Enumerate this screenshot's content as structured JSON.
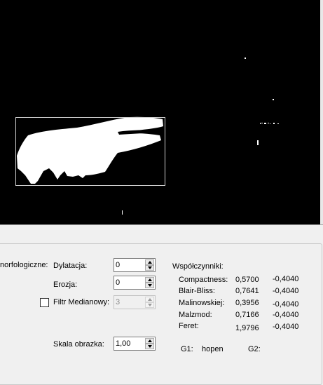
{
  "image_view": {
    "colors": {
      "background": "#000000",
      "foreground": "#ffffff",
      "roi_border": "#d0d0d0"
    }
  },
  "morphology": {
    "section_label": "norfologiczne:",
    "dilation": {
      "label": "Dylatacja:",
      "value": "0"
    },
    "erosion": {
      "label": "Erozja:",
      "value": "0"
    },
    "median_filter": {
      "label": "Filtr Medianowy:",
      "value": "3",
      "checked": false,
      "enabled": false
    },
    "scale": {
      "label": "Skala obrazka:",
      "value": "1,00"
    }
  },
  "coefficients": {
    "title": "Współczynniki:",
    "rows": [
      {
        "name": "Compactness:",
        "value": "0,5700",
        "value2": "-0,4040"
      },
      {
        "name": "Blair-Bliss:",
        "value": "0,7641",
        "value2": "-0,4040"
      },
      {
        "name": "Malinowskiej:",
        "value": "0,3956",
        "value2": "-0,4040"
      },
      {
        "name": "Malzmod:",
        "value": "0,7166",
        "value2": "-0,4040"
      },
      {
        "name": "Feret:",
        "value": "1,9796",
        "value2": "-0,4040"
      }
    ]
  },
  "gestures": {
    "g1_label": "G1:",
    "g1_value": "hopen",
    "g2_label": "G2:",
    "g2_value": ""
  }
}
